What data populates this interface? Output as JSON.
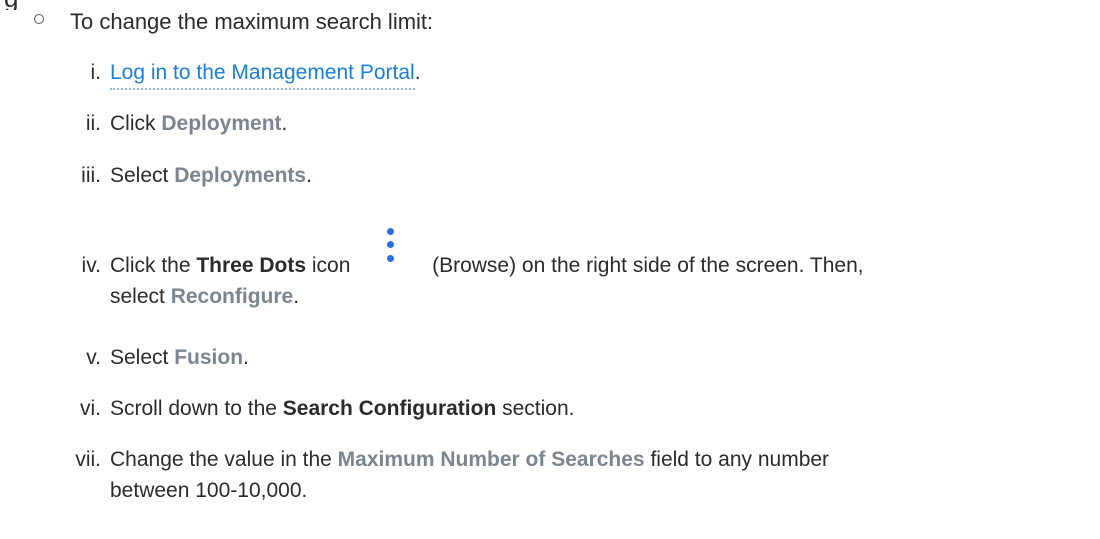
{
  "intro": {
    "text": "To change the maximum search limit:"
  },
  "steps": {
    "s1": {
      "num": "i.",
      "link": "Log in to the Management Portal",
      "after": "."
    },
    "s2": {
      "num": "ii.",
      "before": "Click ",
      "ui": "Deployment",
      "after": "."
    },
    "s3": {
      "num": "iii.",
      "before": "Select ",
      "ui": "Deployments",
      "after": "."
    },
    "s4": {
      "num": "iv.",
      "before": "Click the ",
      "bold": "Three Dots",
      "mid": " icon",
      "after": " (Browse) on the right side of the screen. Then,",
      "line2_before": "select ",
      "line2_ui": "Reconfigure",
      "line2_after": "."
    },
    "s5": {
      "num": "v.",
      "before": "Select ",
      "ui": "Fusion",
      "after": "."
    },
    "s6": {
      "num": "vi.",
      "before": "Scroll down to the ",
      "bold": "Search Configuration",
      "after": " section."
    },
    "s7": {
      "num": "vii.",
      "before": "Change the value in the ",
      "ui": "Maximum Number of Searches",
      "after": " field to any number",
      "line2": "between 100-10,000."
    }
  },
  "icons": {
    "three_dots": "three-dots-vertical-icon",
    "bullet": "hollow-circle-bullet-icon"
  },
  "colors": {
    "link": "#1a7fd6",
    "ui_term": "#7b8591",
    "dots": "#2a6fe0"
  }
}
